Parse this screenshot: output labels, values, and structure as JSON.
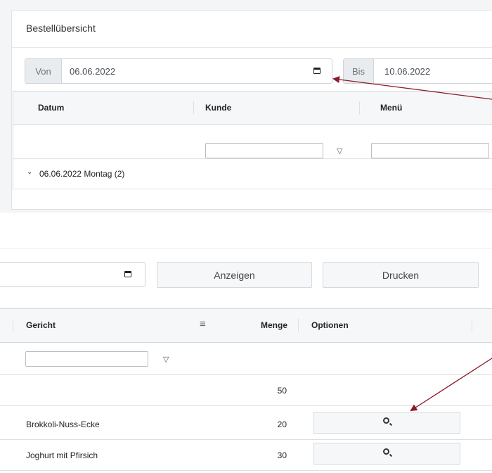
{
  "top": {
    "title": "Bestellübersicht",
    "from_label": "Von",
    "from_value": "06.06.2022",
    "to_label": "Bis",
    "to_value": "10.06.2022",
    "columns": [
      "Datum",
      "Kunde",
      "Menü"
    ],
    "group_row": "06.06.2022 Montag (2)"
  },
  "bottom": {
    "show_button": "Anzeigen",
    "print_button": "Drucken",
    "columns": [
      "Gericht",
      "Menge",
      "Optionen"
    ],
    "menu_icon": "≡",
    "rows": [
      {
        "dish": "",
        "qty": "50"
      },
      {
        "dish": "Brokkoli-Nuss-Ecke",
        "qty": "20"
      },
      {
        "dish": "Joghurt mit Pfirsich",
        "qty": "30"
      }
    ]
  },
  "icons": {
    "calendar": "calendar-icon",
    "filter": "filter-icon",
    "chevron": "chevron-down-icon",
    "search": "search-icon",
    "filter_glyph": "▽",
    "chevron_glyph": "⌄"
  },
  "colors": {
    "arrow": "#8b1a2a",
    "header_bg": "#f6f7f8",
    "addon_bg": "#e9ecef"
  }
}
